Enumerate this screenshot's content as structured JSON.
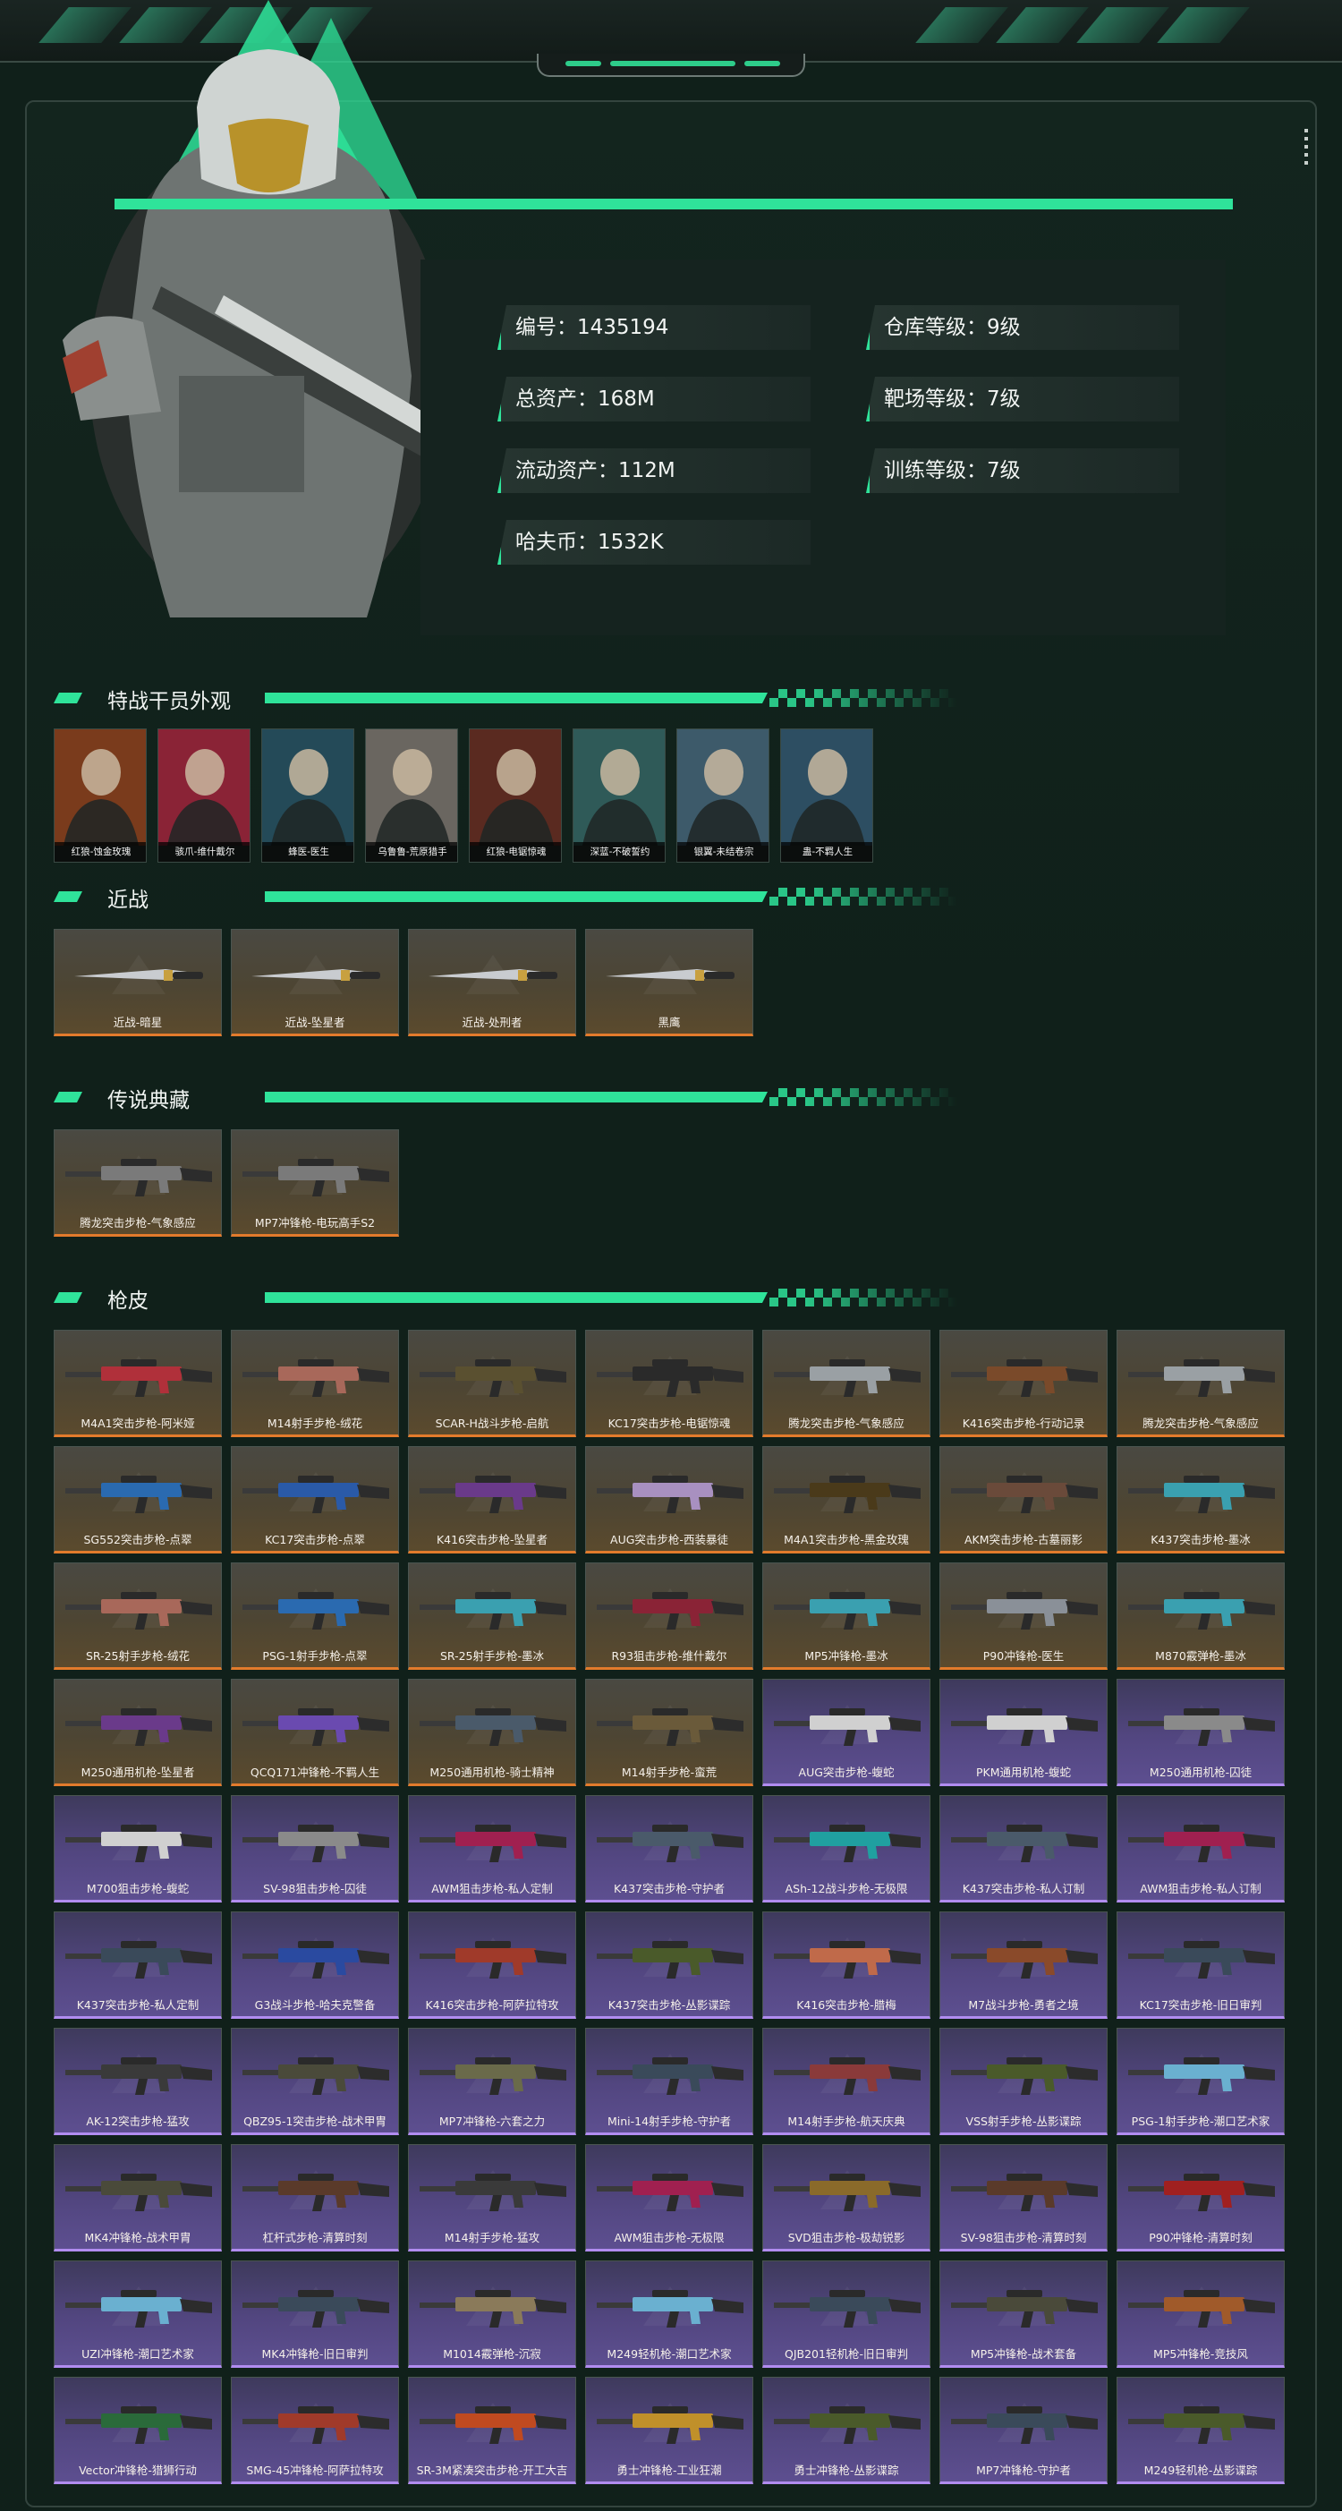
{
  "colors": {
    "accent": "#2fe39a",
    "gold_edge": "#e27b2c",
    "purple_edge": "#b18cf0",
    "bg": "#10201a"
  },
  "profile": {
    "stats": [
      {
        "text": "编号：1435194"
      },
      {
        "text": "仓库等级：9级"
      },
      {
        "text": "总资产：168M"
      },
      {
        "text": "靶场等级：7级"
      },
      {
        "text": "流动资产：112M"
      },
      {
        "text": "训练等级：7级"
      },
      {
        "text": "哈夫币：1532K"
      }
    ]
  },
  "sections": {
    "agents_title": "特战干员外观",
    "melee_title": "近战",
    "legend_title": "传说典藏",
    "skins_title": "枪皮"
  },
  "agents": [
    {
      "name": "红狼-蚀金玫瑰",
      "color": "#7a3b1c"
    },
    {
      "name": "骇爪-维什戴尔",
      "color": "#8a2336"
    },
    {
      "name": "蜂医-医生",
      "color": "#244a58"
    },
    {
      "name": "乌鲁鲁-荒原猎手",
      "color": "#6a6660"
    },
    {
      "name": "红狼-电锯惊魂",
      "color": "#5a2a20"
    },
    {
      "name": "深蓝-不破誓约",
      "color": "#2f5a58"
    },
    {
      "name": "银翼-未结卷宗",
      "color": "#3d5a6a"
    },
    {
      "name": "蛊-不羁人生",
      "color": "#2d4e62"
    }
  ],
  "melee": [
    {
      "name": "近战-暗星",
      "tier": "gold"
    },
    {
      "name": "近战-坠星者",
      "tier": "gold"
    },
    {
      "name": "近战-处刑者",
      "tier": "gold"
    },
    {
      "name": "黑鹰",
      "tier": "gold"
    }
  ],
  "legend": [
    {
      "name": "腾龙突击步枪-气象感应",
      "tier": "gold"
    },
    {
      "name": "MP7冲锋枪-电玩高手S2",
      "tier": "gold"
    }
  ],
  "skins": [
    {
      "name": "M4A1突击步枪-阿米娅",
      "tier": "gold",
      "tint": "#b0303a"
    },
    {
      "name": "M14射手步枪-绒花",
      "tier": "gold",
      "tint": "#a8685a"
    },
    {
      "name": "SCAR-H战斗步枪-启航",
      "tier": "gold",
      "tint": "#5a5030"
    },
    {
      "name": "KC17突击步枪-电锯惊魂",
      "tier": "gold",
      "tint": "#2a2a2a"
    },
    {
      "name": "腾龙突击步枪-气象感应",
      "tier": "gold",
      "tint": "#9aa0a4"
    },
    {
      "name": "K416突击步枪-行动记录",
      "tier": "gold",
      "tint": "#7a4a2a"
    },
    {
      "name": "腾龙突击步枪-气象感应",
      "tier": "gold",
      "tint": "#9aa0a4"
    },
    {
      "name": "SG552突击步枪-点翠",
      "tier": "gold",
      "tint": "#2a6ab0"
    },
    {
      "name": "KC17突击步枪-点翠",
      "tier": "gold",
      "tint": "#2a5aa8"
    },
    {
      "name": "K416突击步枪-坠星者",
      "tier": "gold",
      "tint": "#6a3a8a"
    },
    {
      "name": "AUG突击步枪-西装暴徒",
      "tier": "gold",
      "tint": "#a890c0"
    },
    {
      "name": "M4A1突击步枪-黑金玫瑰",
      "tier": "gold",
      "tint": "#4a3a1a"
    },
    {
      "name": "AKM突击步枪-古墓丽影",
      "tier": "gold",
      "tint": "#6a4a3a"
    },
    {
      "name": "K437突击步枪-墨冰",
      "tier": "gold",
      "tint": "#3aa0b0"
    },
    {
      "name": "SR-25射手步枪-绒花",
      "tier": "gold",
      "tint": "#a8685a"
    },
    {
      "name": "PSG-1射手步枪-点翠",
      "tier": "gold",
      "tint": "#2a6ab0"
    },
    {
      "name": "SR-25射手步枪-墨冰",
      "tier": "gold",
      "tint": "#3aa0b0"
    },
    {
      "name": "R93狙击步枪-维什戴尔",
      "tier": "gold",
      "tint": "#8a2336"
    },
    {
      "name": "MP5冲锋枪-墨冰",
      "tier": "gold",
      "tint": "#3aa0b0"
    },
    {
      "name": "P90冲锋枪-医生",
      "tier": "gold",
      "tint": "#8a9098"
    },
    {
      "name": "M870霰弹枪-墨冰",
      "tier": "gold",
      "tint": "#3aa0b0"
    },
    {
      "name": "M250通用机枪-坠星者",
      "tier": "gold",
      "tint": "#6a3a8a"
    },
    {
      "name": "QCQ171冲锋枪-不羁人生",
      "tier": "gold",
      "tint": "#6a4ab0"
    },
    {
      "name": "M250通用机枪-骑士精神",
      "tier": "gold",
      "tint": "#4a5a6a"
    },
    {
      "name": "M14射手步枪-蛮荒",
      "tier": "gold",
      "tint": "#6a5a3a"
    },
    {
      "name": "AUG突击步枪-蝮蛇",
      "tier": "purple",
      "tint": "#d0d0d0"
    },
    {
      "name": "PKM通用机枪-蝮蛇",
      "tier": "purple",
      "tint": "#d0d0d0"
    },
    {
      "name": "M250通用机枪-囚徒",
      "tier": "purple",
      "tint": "#8a8a8a"
    },
    {
      "name": "M700狙击步枪-蝮蛇",
      "tier": "purple",
      "tint": "#d0d0d0"
    },
    {
      "name": "SV-98狙击步枪-囚徒",
      "tier": "purple",
      "tint": "#8a8a8a"
    },
    {
      "name": "AWM狙击步枪-私人定制",
      "tier": "purple",
      "tint": "#a02050"
    },
    {
      "name": "K437突击步枪-守护者",
      "tier": "purple",
      "tint": "#4a5a6a"
    },
    {
      "name": "ASh-12战斗步枪-无极限",
      "tier": "purple",
      "tint": "#20a0a0"
    },
    {
      "name": "K437突击步枪-私人订制",
      "tier": "purple",
      "tint": "#4a5a6a"
    },
    {
      "name": "AWM狙击步枪-私人订制",
      "tier": "purple",
      "tint": "#a02050"
    },
    {
      "name": "K437突击步枪-私人定制",
      "tier": "purple",
      "tint": "#3a4a5a"
    },
    {
      "name": "G3战斗步枪-哈夫克警备",
      "tier": "purple",
      "tint": "#2a4aa0"
    },
    {
      "name": "K416突击步枪-阿萨拉特攻",
      "tier": "purple",
      "tint": "#a03a2a"
    },
    {
      "name": "K437突击步枪-丛影谍踪",
      "tier": "purple",
      "tint": "#4a5a2a"
    },
    {
      "name": "K416突击步枪-腊梅",
      "tier": "purple",
      "tint": "#c06a4a"
    },
    {
      "name": "M7战斗步枪-勇者之境",
      "tier": "purple",
      "tint": "#8a4a2a"
    },
    {
      "name": "KC17突击步枪-旧日审判",
      "tier": "purple",
      "tint": "#3a4a5a"
    },
    {
      "name": "AK-12突击步枪-猛攻",
      "tier": "purple",
      "tint": "#3a3a3a"
    },
    {
      "name": "QBZ95-1突击步枪-战术甲胄",
      "tier": "purple",
      "tint": "#4a4a3a"
    },
    {
      "name": "MP7冲锋枪-六套之力",
      "tier": "purple",
      "tint": "#6a6a4a"
    },
    {
      "name": "Mini-14射手步枪-守护者",
      "tier": "purple",
      "tint": "#3a4a5a"
    },
    {
      "name": "M14射手步枪-航天庆典",
      "tier": "purple",
      "tint": "#8a3a3a"
    },
    {
      "name": "VSS射手步枪-丛影谍踪",
      "tier": "purple",
      "tint": "#4a5a2a"
    },
    {
      "name": "PSG-1射手步枪-潮口艺术家",
      "tier": "purple",
      "tint": "#6ab0d0"
    },
    {
      "name": "MK4冲锋枪-战术甲胄",
      "tier": "purple",
      "tint": "#4a4a3a"
    },
    {
      "name": "杠杆式步枪-清算时刻",
      "tier": "purple",
      "tint": "#5a3a2a"
    },
    {
      "name": "M14射手步枪-猛攻",
      "tier": "purple",
      "tint": "#3a3a3a"
    },
    {
      "name": "AWM狙击步枪-无极限",
      "tier": "purple",
      "tint": "#a02050"
    },
    {
      "name": "SVD狙击步枪-极劫锐影",
      "tier": "purple",
      "tint": "#8a6a2a"
    },
    {
      "name": "SV-98狙击步枪-清算时刻",
      "tier": "purple",
      "tint": "#5a3a2a"
    },
    {
      "name": "P90冲锋枪-清算时刻",
      "tier": "purple",
      "tint": "#a02020"
    },
    {
      "name": "UZI冲锋枪-潮口艺术家",
      "tier": "purple",
      "tint": "#6ab0d0"
    },
    {
      "name": "MK4冲锋枪-旧日审判",
      "tier": "purple",
      "tint": "#3a4a5a"
    },
    {
      "name": "M1014霰弹枪-沉寂",
      "tier": "purple",
      "tint": "#8a7a5a"
    },
    {
      "name": "M249轻机枪-潮口艺术家",
      "tier": "purple",
      "tint": "#6ab0d0"
    },
    {
      "name": "QJB201轻机枪-旧日审判",
      "tier": "purple",
      "tint": "#3a4a5a"
    },
    {
      "name": "MP5冲锋枪-战术套备",
      "tier": "purple",
      "tint": "#4a4a3a"
    },
    {
      "name": "MP5冲锋枪-竞技风",
      "tier": "purple",
      "tint": "#a05a2a"
    },
    {
      "name": "Vector冲锋枪-猎狮行动",
      "tier": "purple",
      "tint": "#2a6a3a"
    },
    {
      "name": "SMG-45冲锋枪-阿萨拉特攻",
      "tier": "purple",
      "tint": "#a03a2a"
    },
    {
      "name": "SR-3M紧凑突击步枪-开工大吉",
      "tier": "purple",
      "tint": "#c04a20"
    },
    {
      "name": "勇士冲锋枪-工业狂潮",
      "tier": "purple",
      "tint": "#c0902a"
    },
    {
      "name": "勇士冲锋枪-丛影谍踪",
      "tier": "purple",
      "tint": "#4a5a2a"
    },
    {
      "name": "MP7冲锋枪-守护者",
      "tier": "purple",
      "tint": "#3a4a5a"
    },
    {
      "name": "M249轻机枪-丛影谍踪",
      "tier": "purple",
      "tint": "#4a5a2a"
    }
  ]
}
